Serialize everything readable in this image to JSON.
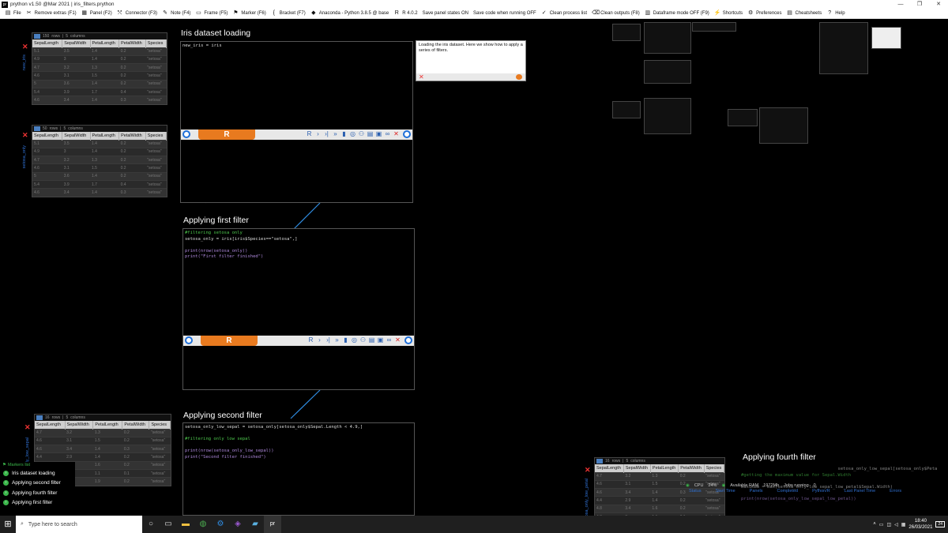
{
  "window": {
    "title": "prython v1.50 @Mar 2021 | iris_filters.prython",
    "app_icon": "pr",
    "controls": [
      "—",
      "❐",
      "✕"
    ]
  },
  "menu": [
    {
      "label": "File",
      "icon": "file-icon",
      "glyph": "▤"
    },
    {
      "label": "Remove extras (F1)",
      "icon": "remove-icon",
      "glyph": "✂"
    },
    {
      "label": "Panel (F2)",
      "icon": "panel-icon",
      "glyph": "▦"
    },
    {
      "label": "Connector (F3)",
      "icon": "connector-icon",
      "glyph": "⤲"
    },
    {
      "label": "Note (F4)",
      "icon": "note-icon",
      "glyph": "✎"
    },
    {
      "label": "Frame (F5)",
      "icon": "frame-icon",
      "glyph": "▭"
    },
    {
      "label": "Marker (F6)",
      "icon": "marker-icon",
      "glyph": "⚑"
    },
    {
      "label": "Bracket (F7)",
      "icon": "bracket-icon",
      "glyph": "{"
    },
    {
      "label": "Anaconda - Python 3.8.5 @ base",
      "icon": "python-icon",
      "glyph": "◆"
    },
    {
      "label": "R 4.0.2",
      "icon": "r-icon",
      "glyph": "R"
    },
    {
      "label": "Save panel states ON",
      "icon": "",
      "glyph": ""
    },
    {
      "label": "Save code when running OFF",
      "icon": "",
      "glyph": ""
    },
    {
      "label": "Clean process list",
      "icon": "clean-icon",
      "glyph": "✓"
    },
    {
      "label": "Clean outputs (F8)",
      "icon": "broom-icon",
      "glyph": "⌫"
    },
    {
      "label": "Dataframe mode OFF (F9)",
      "icon": "dataframe-icon",
      "glyph": "▥"
    },
    {
      "label": "Shortcuts",
      "icon": "shortcuts-icon",
      "glyph": "⚡"
    },
    {
      "label": "Preferences",
      "icon": "gear-icon",
      "glyph": "⚙"
    },
    {
      "label": "Cheatsheets",
      "icon": "cheatsheet-icon",
      "glyph": "▤"
    },
    {
      "label": "Help",
      "icon": "help-icon",
      "glyph": "?"
    }
  ],
  "frames": [
    {
      "title": "Iris dataset loading"
    },
    {
      "title": "Applying first filter"
    },
    {
      "title": "Applying second filter"
    },
    {
      "title": "Applying fourth filter"
    }
  ],
  "code": {
    "loading": "new_iris = iris",
    "first": [
      "#filtering setosa only",
      "setosa_only = iris[iris$Species==\"setosa\",]",
      "",
      "print(nrow(setosa_only))",
      "print(\"First filter finished\")"
    ],
    "second": [
      "setosa_only_low_sepal = setosa_only[setosa_only$Sepal.Length < 4.9,]",
      "",
      "#filtering only low sepal",
      "",
      "print(nrow(setosa_only_low_sepal))",
      "print(\"Second filter finished\")"
    ],
    "fourth": [
      "                                     setosa_only_low_sepal[setosa_only$Peta",
      "#getting the maximum value for Sepal.Width",
      "",
      "maximum = max(setosa_only_low_sepal_low_petal$Sepal.Width)",
      "",
      "print(nrow(setosa_only_low_sepal_low_petal))"
    ]
  },
  "note": {
    "text": "Loading the iris dataset. Here we show how to apply a series of filters."
  },
  "dataframes": [
    {
      "side": "new_iris",
      "rows_label": "150",
      "rows_word": "rows",
      "cols_label": "5",
      "cols_word": "columns"
    },
    {
      "side": "setosa_only",
      "rows_label": "50",
      "rows_word": "rows",
      "cols_label": "5",
      "cols_word": "columns"
    },
    {
      "side": "setosa_only_low_sepal",
      "rows_label": "16",
      "rows_word": "rows",
      "cols_label": "5",
      "cols_word": "columns"
    },
    {
      "side": "setosa_only_low_petal",
      "rows_label": "16",
      "rows_word": "rows",
      "cols_label": "5",
      "cols_word": "columns"
    }
  ],
  "table_headers": [
    "SepalLength",
    "SepalWidth",
    "PetalLength",
    "PetalWidth",
    "Species"
  ],
  "table_rows_a": [
    [
      "5.1",
      "3.5",
      "1.4",
      "0.2",
      "\"setosa\""
    ],
    [
      "4.9",
      "3",
      "1.4",
      "0.2",
      "\"setosa\""
    ],
    [
      "4.7",
      "3.2",
      "1.3",
      "0.2",
      "\"setosa\""
    ],
    [
      "4.6",
      "3.1",
      "1.5",
      "0.2",
      "\"setosa\""
    ],
    [
      "5",
      "3.6",
      "1.4",
      "0.2",
      "\"setosa\""
    ],
    [
      "5.4",
      "3.9",
      "1.7",
      "0.4",
      "\"setosa\""
    ],
    [
      "4.6",
      "3.4",
      "1.4",
      "0.3",
      "\"setosa\""
    ]
  ],
  "table_rows_c": [
    [
      "4.7",
      "3.2",
      "1.3",
      "0.2",
      "\"setosa\""
    ],
    [
      "4.6",
      "3.1",
      "1.5",
      "0.2",
      "\"setosa\""
    ],
    [
      "4.6",
      "3.4",
      "1.4",
      "0.3",
      "\"setosa\""
    ],
    [
      "4.4",
      "2.9",
      "1.4",
      "0.2",
      "\"setosa\""
    ],
    [
      "4.8",
      "3.4",
      "1.6",
      "0.2",
      "\"setosa\""
    ],
    [
      "4.3",
      "3",
      "1.1",
      "0.1",
      "\"setosa\""
    ],
    [
      "4.8",
      "3.4",
      "1.9",
      "0.2",
      "\"setosa\""
    ]
  ],
  "markers": {
    "title": "Markers list",
    "items": [
      "Iris dataset loading",
      "Applying second filter",
      "Applying fourth filter",
      "Applying first filter"
    ]
  },
  "status": {
    "cpu_label": "CPU",
    "cpu": "24%",
    "ram_label": "Available RAM",
    "ram": "1972Mb",
    "jobs_label": "Jobs running",
    "jobs": "0"
  },
  "status_tabs": [
    "Status",
    "Start Time",
    "Panels",
    "Completed",
    "Python/R",
    "Last Panel Time",
    "Errors"
  ],
  "taskbar": {
    "search_placeholder": "Type here to search",
    "time": "18:40",
    "date": "26/03/2021",
    "notif": "24"
  },
  "colors": {
    "accent": "#1e6fd9",
    "logo": "#e87a1f",
    "marker": "#3ab54a",
    "close": "#e33333"
  }
}
